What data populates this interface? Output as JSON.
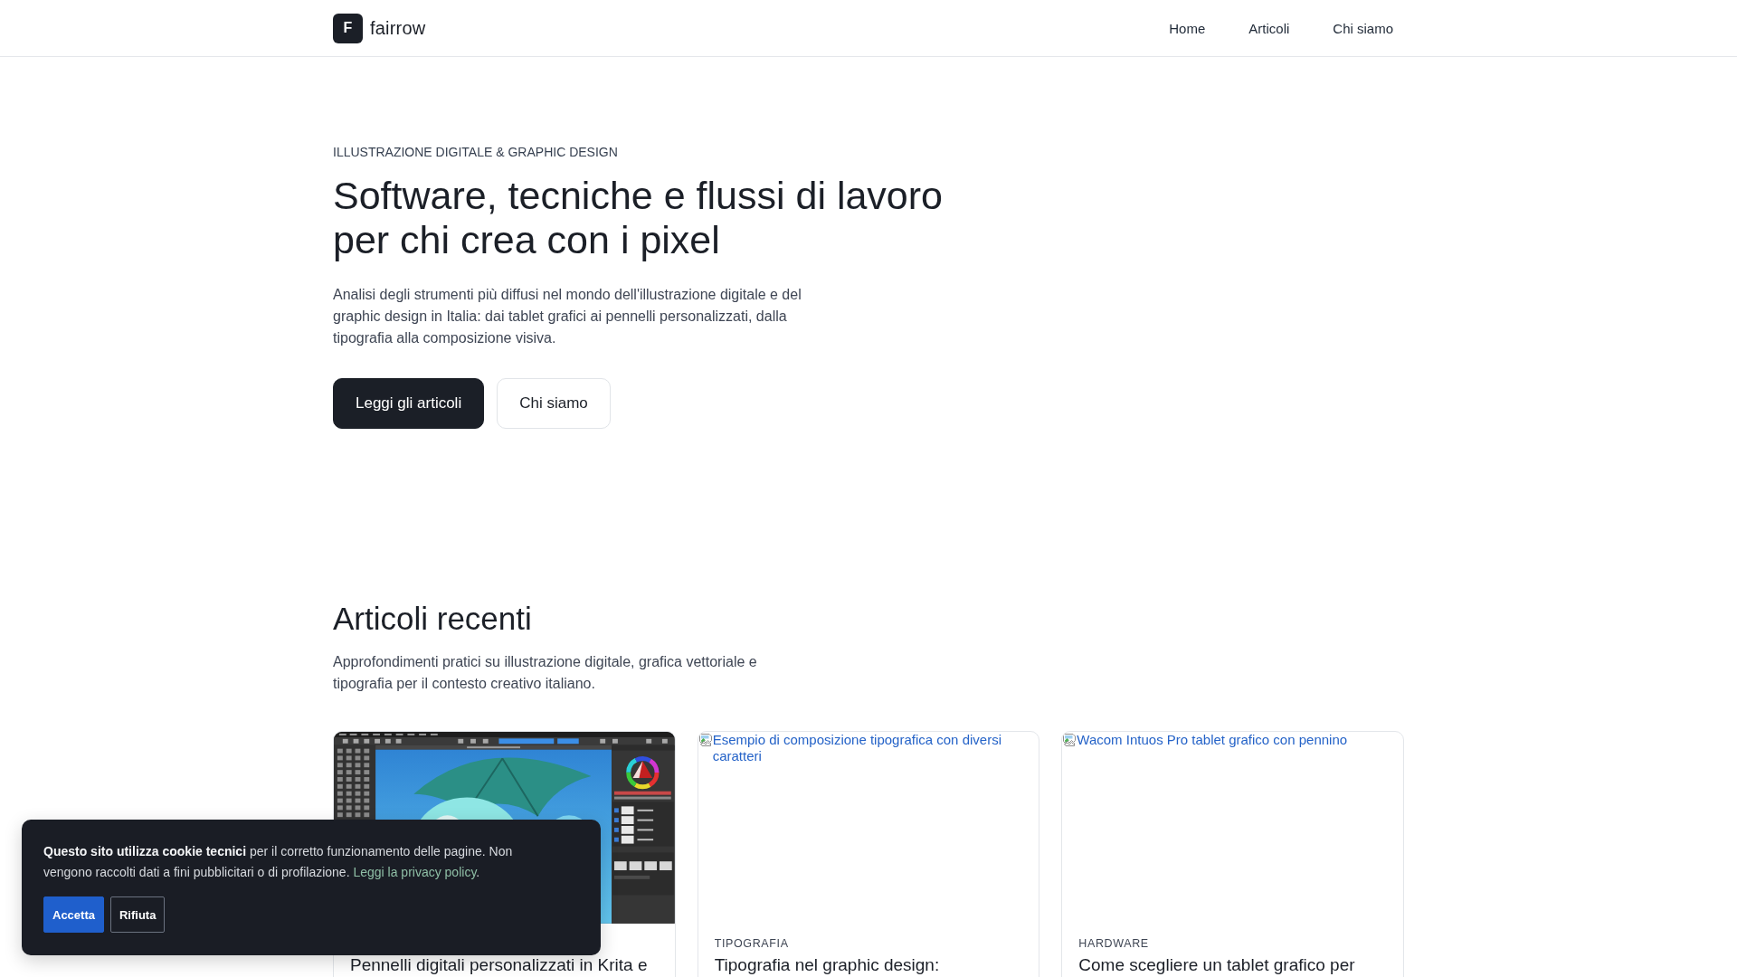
{
  "header": {
    "logo_letter": "F",
    "brand": "fairrow",
    "nav": [
      "Home",
      "Articoli",
      "Chi siamo"
    ]
  },
  "hero": {
    "eyebrow": "ILLUSTRAZIONE DIGITALE & GRAPHIC DESIGN",
    "title": "Software, tecniche e flussi di lavoro per chi crea con i pixel",
    "text": "Analisi degli strumenti più diffusi nel mondo dell'illustrazione digitale e del graphic design in Italia: dai tablet grafici ai pennelli personalizzati, dalla tipografia alla composizione visiva.",
    "buttons": [
      {
        "label": "Leggi gli articoli",
        "kind": "primary"
      },
      {
        "label": "Chi siamo",
        "kind": "secondary"
      }
    ]
  },
  "recent": {
    "title": "Articoli recenti",
    "text": "Approfondimenti pratici su illustrazione digitale, grafica vettoriale e tipografia per il contesto creativo italiano.",
    "articles": [
      {
        "image": {
          "kind": "screenshot"
        },
        "title": "Pennelli digitali personalizzati in Krita e"
      },
      {
        "image": {
          "kind": "broken",
          "alt": "Esempio di composizione tipografica con diversi caratteri"
        },
        "category": "TIPOGRAFIA",
        "title": "Tipografia nel graphic design:"
      },
      {
        "image": {
          "kind": "broken",
          "alt": "Wacom Intuos Pro tablet grafico con pennino"
        },
        "category": "HARDWARE",
        "title": "Come scegliere un tablet grafico per"
      }
    ]
  },
  "cookie_banner": {
    "text": "**Questo sito utilizza cookie tecnici** per il corretto funzionamento delle pagine. Non vengono raccolti dati a fini pubblicitari o di profilazione.",
    "link": "Leggi la privacy policy",
    "text_end": ".",
    "buttons": [
      {
        "label": "Accetta",
        "kind": "accept"
      },
      {
        "label": "Rifiuta",
        "kind": "decline"
      }
    ]
  }
}
